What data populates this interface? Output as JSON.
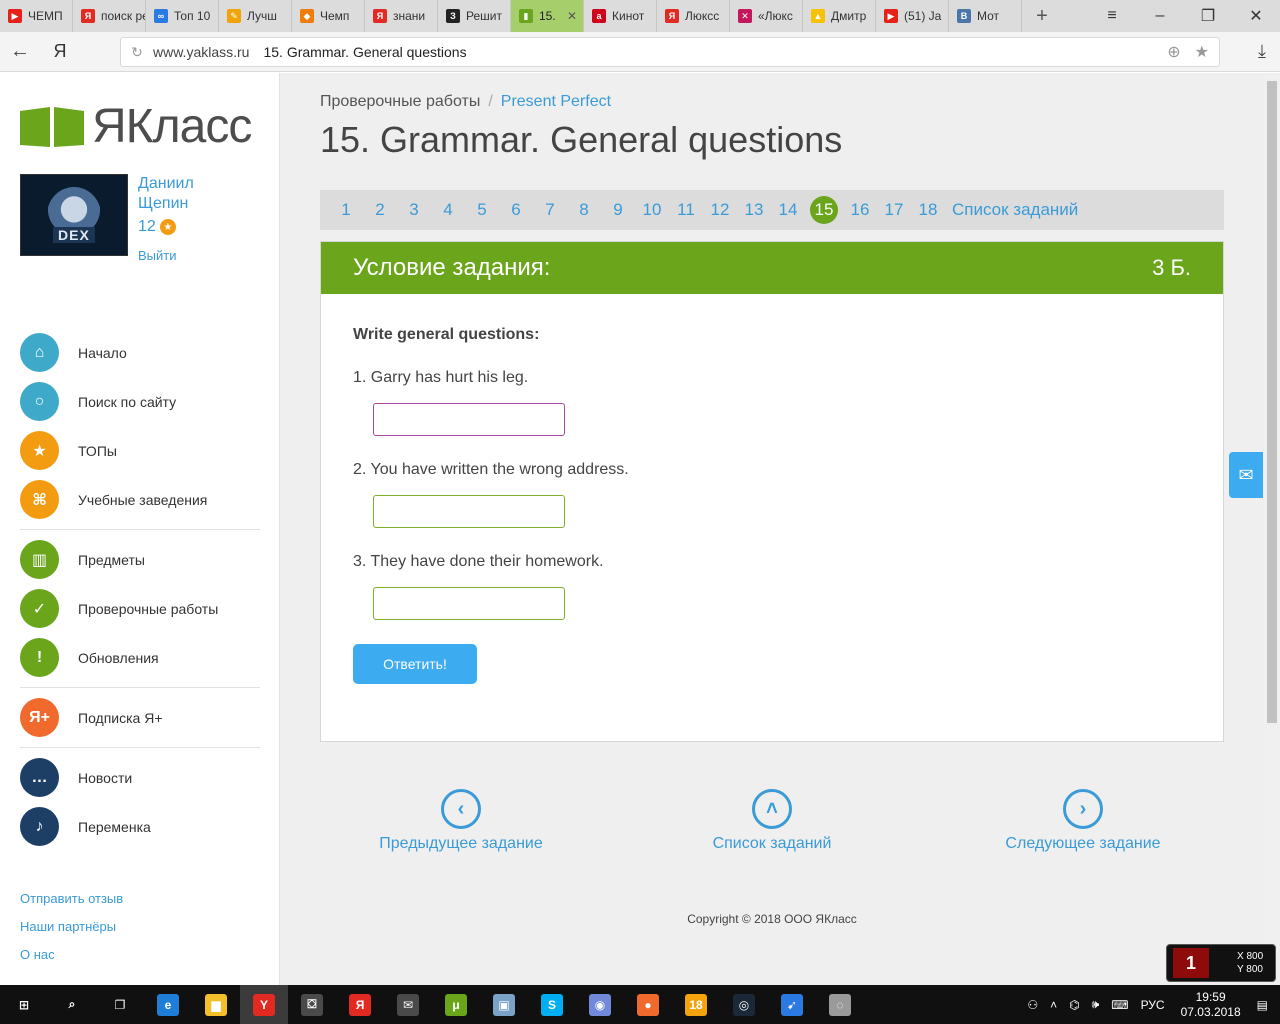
{
  "browser": {
    "tabs": [
      {
        "label": "ЧЕМП",
        "color": "#e62117",
        "glyph": "▶",
        "active": false
      },
      {
        "label": "поиск ре",
        "color": "#e22a23",
        "glyph": "Я",
        "active": false
      },
      {
        "label": "Топ 10",
        "color": "#2a7ae2",
        "glyph": "∞",
        "active": false
      },
      {
        "label": "Лучш",
        "color": "#f0a30a",
        "glyph": "✎",
        "active": false
      },
      {
        "label": "Чемп",
        "color": "#f07d0a",
        "glyph": "◆",
        "active": false
      },
      {
        "label": "знани",
        "color": "#e22a23",
        "glyph": "Я",
        "active": false
      },
      {
        "label": "Решит",
        "color": "#222222",
        "glyph": "З",
        "active": false
      },
      {
        "label": "15.",
        "color": "#6aa51c",
        "glyph": "▮",
        "active": true
      },
      {
        "label": "Кинот",
        "color": "#d0021b",
        "glyph": "а",
        "active": false
      },
      {
        "label": "Люксс",
        "color": "#e22a23",
        "glyph": "Я",
        "active": false
      },
      {
        "label": "«Люкс",
        "color": "#c2185b",
        "glyph": "✕",
        "active": false
      },
      {
        "label": "Дмитр",
        "color": "#f7c200",
        "glyph": "▲",
        "active": false
      },
      {
        "label": "(51) Ja",
        "color": "#e62117",
        "glyph": "▶",
        "active": false
      },
      {
        "label": "Мот",
        "color": "#4a76a8",
        "glyph": "В",
        "active": false
      }
    ],
    "new_tab": "+",
    "window_controls": {
      "menu": "≡",
      "minimize": "–",
      "maximize": "❐",
      "close": "✕"
    },
    "back": "←",
    "ya": "Я",
    "url_domain": "www.yaklass.ru",
    "url_title": "15. Grammar. General questions",
    "download": "⤓"
  },
  "sidebar": {
    "logo_text": "ЯКласс",
    "user_first": "Даниил",
    "user_last": "Щепин",
    "avatar_text": "DEX",
    "score": "12",
    "logout": "Выйти",
    "menu_groups": [
      [
        {
          "label": "Начало",
          "icon": "home-icon",
          "glyph": "⌂",
          "color": "#3fa9c9"
        },
        {
          "label": "Поиск по сайту",
          "icon": "search-icon",
          "glyph": "○",
          "color": "#3fa9c9"
        },
        {
          "label": "ТОПы",
          "icon": "star-icon",
          "glyph": "★",
          "color": "#f39c12"
        },
        {
          "label": "Учебные заведения",
          "icon": "school-icon",
          "glyph": "⌘",
          "color": "#f39c12"
        }
      ],
      [
        {
          "label": "Предметы",
          "icon": "book-icon",
          "glyph": "▥",
          "color": "#6aa51c"
        },
        {
          "label": "Проверочные работы",
          "icon": "check-icon",
          "glyph": "✓",
          "color": "#6aa51c"
        },
        {
          "label": "Обновления",
          "icon": "exclamation-icon",
          "glyph": "!",
          "color": "#6aa51c"
        }
      ],
      [
        {
          "label": "Подписка Я+",
          "icon": "ya-plus-icon",
          "glyph": "Я+",
          "color": "#ef6a2c"
        }
      ],
      [
        {
          "label": "Новости",
          "icon": "chat-icon",
          "glyph": "…",
          "color": "#1d3f66"
        },
        {
          "label": "Переменка",
          "icon": "bell-icon",
          "glyph": "♪",
          "color": "#1d3f66"
        }
      ]
    ],
    "footer_links": [
      "Отправить отзыв",
      "Наши партнёры",
      "О нас"
    ]
  },
  "main": {
    "breadcrumb_root": "Проверочные работы",
    "breadcrumb_sep": "/",
    "breadcrumb_current": "Present Perfect",
    "title": "15. Grammar. General questions",
    "pager": {
      "pages": [
        "1",
        "2",
        "3",
        "4",
        "5",
        "6",
        "7",
        "8",
        "9",
        "10",
        "11",
        "12",
        "13",
        "14",
        "15",
        "16",
        "17",
        "18"
      ],
      "current": "15",
      "list_link": "Список заданий"
    },
    "task": {
      "header": "Условие задания:",
      "points": "3 Б.",
      "instruction": "Write general questions:",
      "questions": [
        {
          "text": "1. Garry has hurt his leg.",
          "value": "",
          "placeholder": ""
        },
        {
          "text": "2. You have written the wrong address.",
          "value": "",
          "placeholder": ""
        },
        {
          "text": "3. They have done their homework.",
          "value": "",
          "placeholder": ""
        }
      ],
      "submit": "Ответить!"
    },
    "nav": {
      "prev": "Предыдущее задание",
      "list": "Список заданий",
      "next": "Следующее задание"
    },
    "copyright": "Copyright © 2018 ООО ЯКласс"
  },
  "overlay": {
    "mail_icon": "✉",
    "game_x": "X 800",
    "game_y": "Y 800"
  },
  "taskbar": {
    "language": "РУС",
    "time": "19:59",
    "date": "07.03.2018",
    "apps": [
      {
        "name": "windows-start-icon",
        "glyph": "⊞",
        "color": "#101010"
      },
      {
        "name": "search-icon",
        "glyph": "⌕",
        "color": "#101010"
      },
      {
        "name": "task-view-icon",
        "glyph": "❐",
        "color": "#101010"
      },
      {
        "name": "edge-icon",
        "glyph": "e",
        "color": "#1f7fd8"
      },
      {
        "name": "explorer-icon",
        "glyph": "▆",
        "color": "#f3c02c"
      },
      {
        "name": "yandex-browser-icon",
        "glyph": "Y",
        "color": "#e22a23"
      },
      {
        "name": "store-icon",
        "glyph": "⛋",
        "color": "#4a4a4a"
      },
      {
        "name": "yandex-icon",
        "glyph": "Я",
        "color": "#e22a23"
      },
      {
        "name": "mail-icon",
        "glyph": "✉",
        "color": "#4a4a4a"
      },
      {
        "name": "utorrent-icon",
        "glyph": "μ",
        "color": "#6aa51c"
      },
      {
        "name": "monitor-icon",
        "glyph": "▣",
        "color": "#7aa3c7"
      },
      {
        "name": "skype-icon",
        "glyph": "S",
        "color": "#00aff0"
      },
      {
        "name": "discord-icon",
        "glyph": "◉",
        "color": "#7289da"
      },
      {
        "name": "maps-icon",
        "glyph": "●",
        "color": "#ef6a2c"
      },
      {
        "name": "game18-icon",
        "glyph": "18",
        "color": "#f3a40d"
      },
      {
        "name": "steam-icon",
        "glyph": "◎",
        "color": "#1b2838"
      },
      {
        "name": "arrow-icon",
        "glyph": "➹",
        "color": "#2a7ae2"
      },
      {
        "name": "disc-icon",
        "glyph": "◌",
        "color": "#9a9a9a"
      }
    ]
  }
}
